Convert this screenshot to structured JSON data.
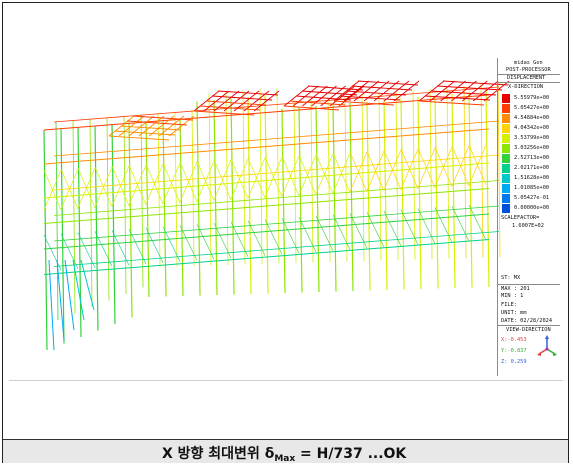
{
  "legend": {
    "software": "midas Gen",
    "module": "POST-PROCESSOR",
    "result_type": "DISPLACEMENT",
    "component": "X-DIRECTION",
    "scale_values": [
      {
        "value": "5.55979e+00",
        "color": "#e60000"
      },
      {
        "value": "5.05427e+00",
        "color": "#ff3c00"
      },
      {
        "value": "4.54884e+00",
        "color": "#ff8c00"
      },
      {
        "value": "4.04342e+00",
        "color": "#ffd200"
      },
      {
        "value": "3.53799e+00",
        "color": "#d7f000"
      },
      {
        "value": "3.03256e+00",
        "color": "#8ce600"
      },
      {
        "value": "2.52713e+00",
        "color": "#32d23c"
      },
      {
        "value": "2.02171e+00",
        "color": "#00d28c"
      },
      {
        "value": "1.51628e+00",
        "color": "#00c8c8"
      },
      {
        "value": "1.01085e+00",
        "color": "#00aaf0"
      },
      {
        "value": "5.05427e-01",
        "color": "#0078f0"
      },
      {
        "value": "0.00000e+00",
        "color": "#0050dc"
      }
    ],
    "scale_factor_label": "SCALEFACTOR=",
    "scale_factor_value": "1.6007E+02",
    "st": "ST: MX",
    "max": "MAX : 201",
    "min": "MIN : 1",
    "file": "FILE:",
    "unit": "UNIT: mm",
    "date": "DATE: 02/28/2024",
    "view_direction": "VIEW-DIRECTION",
    "view_x": "X:-0.453",
    "view_y": "Y:-0.837",
    "view_z": "Z: 0.259"
  },
  "caption": {
    "prefix": "X 방향 최대변위 δ",
    "sub": "Max",
    "suffix": " = H/737      ...OK"
  },
  "colors": {
    "axis_x": "#e04040",
    "axis_y": "#30b030",
    "axis_z": "#3060e0"
  }
}
